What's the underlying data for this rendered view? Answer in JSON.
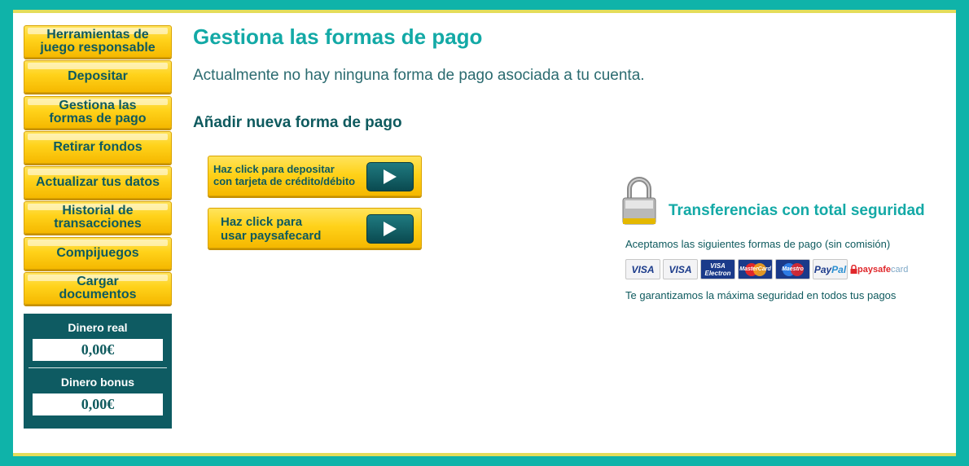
{
  "sidebar": {
    "items": [
      {
        "label_line1": "Herramientas de",
        "label_line2": "juego responsable"
      },
      {
        "label_line1": "Depositar",
        "label_line2": ""
      },
      {
        "label_line1": "Gestiona las",
        "label_line2": "formas de pago"
      },
      {
        "label_line1": "Retirar fondos",
        "label_line2": ""
      },
      {
        "label_line1": "Actualizar tus datos",
        "label_line2": ""
      },
      {
        "label_line1": "Historial de",
        "label_line2": "transacciones"
      },
      {
        "label_line1": "Compijuegos",
        "label_line2": ""
      },
      {
        "label_line1": "Cargar",
        "label_line2": "documentos"
      }
    ],
    "wallet": {
      "real_label": "Dinero real",
      "real_value": "0,00€",
      "bonus_label": "Dinero bonus",
      "bonus_value": "0,00€"
    }
  },
  "main": {
    "title": "Gestiona las formas de pago",
    "description": "Actualmente no hay ninguna forma de pago asociada a tu cuenta.",
    "subtitle": "Añadir nueva forma de pago",
    "buttons": {
      "card_line1": "Haz click para depositar",
      "card_line2": "con tarjeta de crédito/débito",
      "psc_line1": "Haz click para",
      "psc_line2": "usar paysafecard"
    }
  },
  "security": {
    "title": "Transferencias con total seguridad",
    "accept": "Aceptamos las siguientes formas de pago (sin comisión)",
    "guarantee": "Te garantizamos la máxima seguridad en todos tus pagos",
    "cards": {
      "visa": "VISA",
      "visa_electron_1": "VISA",
      "visa_electron_2": "Electron",
      "mastercard": "MasterCard",
      "maestro": "Maestro",
      "paypal_1": "Pay",
      "paypal_2": "Pal",
      "psc_1": "paysafe",
      "psc_2": "card"
    }
  },
  "colors": {
    "background": "#0fb3a9",
    "accent": "#13a9a6",
    "dark_teal": "#0e5a5e",
    "button_yellow": "#ffd21a"
  }
}
